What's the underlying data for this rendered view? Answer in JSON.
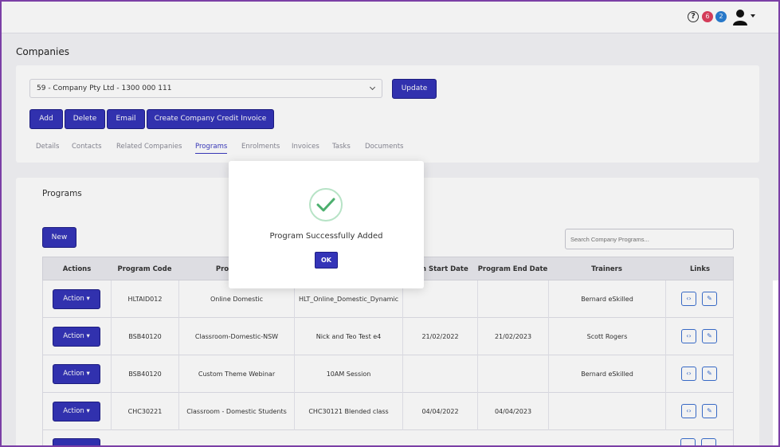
{
  "header": {
    "help_icon": "?",
    "notification_badge_red": "6",
    "notification_badge_blue": "2",
    "icons": [
      "help-icon",
      "user-icon",
      "caret-down-icon"
    ]
  },
  "page": {
    "title": "Companies"
  },
  "company": {
    "selected": "59 - Company Pty Ltd - 1300 000 111",
    "update_label": "Update"
  },
  "toolbar": {
    "add_label": "Add",
    "delete_label": "Delete",
    "email_label": "Email",
    "credit_label": "Create Company Credit Invoice"
  },
  "tabs": [
    {
      "label": "Details"
    },
    {
      "label": "Contacts"
    },
    {
      "label": "Related Companies"
    },
    {
      "label": "Programs",
      "active": true
    },
    {
      "label": "Enrolments"
    },
    {
      "label": "Invoices"
    },
    {
      "label": "Tasks"
    },
    {
      "label": "Documents"
    }
  ],
  "programs": {
    "title": "Programs",
    "new_label": "New",
    "search_placeholder": "Search Company Programs...",
    "columns": [
      "Actions",
      "Program Code",
      "Program N",
      "",
      "ram Start Date",
      "Program End Date",
      "Trainers",
      "Links"
    ],
    "rows": [
      {
        "action": "Action",
        "code": "HLTAID012",
        "name": "Online Domestic",
        "group": "HLT_Online_Domestic_Dynamic",
        "start": "",
        "end": "",
        "trainer": "Bernard eSkilled"
      },
      {
        "action": "Action",
        "code": "BSB40120",
        "name": "Classroom-Domestic-NSW",
        "group": "Nick and Teo Test e4",
        "start": "21/02/2022",
        "end": "21/02/2023",
        "trainer": "Scott Rogers"
      },
      {
        "action": "Action",
        "code": "BSB40120",
        "name": "Custom Theme Webinar",
        "group": "10AM Session",
        "start": "",
        "end": "",
        "trainer": "Bernard eSkilled"
      },
      {
        "action": "Action",
        "code": "CHC30221",
        "name": "Classroom - Domestic Students",
        "group": "CHC30121 Blended class",
        "start": "04/04/2022",
        "end": "04/04/2023",
        "trainer": ""
      }
    ],
    "link_icons": [
      "code-icon",
      "edit-link-icon"
    ]
  },
  "modal": {
    "message": "Program Successfully Added",
    "ok_label": "OK",
    "icon": "check-icon"
  },
  "colors": {
    "primary": "#3434b8",
    "frame": "#7b3fa6",
    "success": "#4caf6e"
  }
}
